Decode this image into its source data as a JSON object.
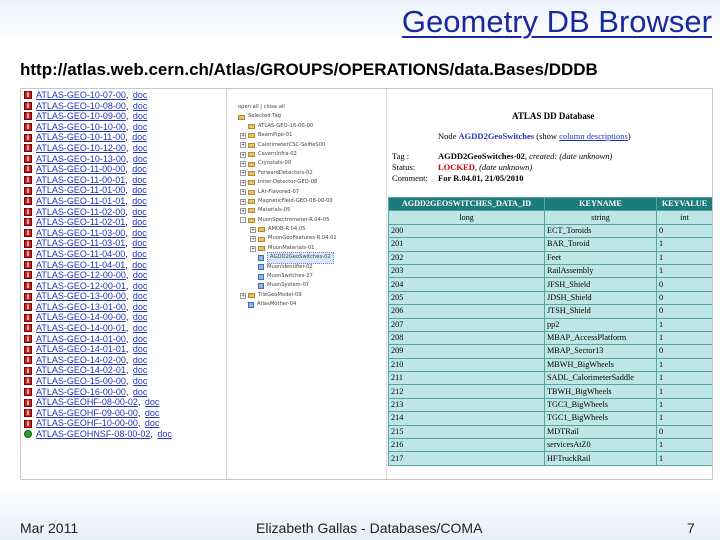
{
  "slide": {
    "title": "Geometry DB Browser",
    "url": "http://atlas.web.cern.ch/Atlas/GROUPS/OPERATIONS/data.Bases/DDDB"
  },
  "tag_list": [
    {
      "name": "ATLAS-GEO-10-07-00",
      "doc": "doc"
    },
    {
      "name": "ATLAS-GEO-10-08-00",
      "doc": "doc"
    },
    {
      "name": "ATLAS-GEO-10-09-00",
      "doc": "doc"
    },
    {
      "name": "ATLAS-GEO-10-10-00",
      "doc": "doc"
    },
    {
      "name": "ATLAS-GEO-10-11-00",
      "doc": "doc"
    },
    {
      "name": "ATLAS-GEO-10-12-00",
      "doc": "doc"
    },
    {
      "name": "ATLAS-GEO-10-13-00",
      "doc": "doc"
    },
    {
      "name": "ATLAS-GEO-11-00-00",
      "doc": "doc"
    },
    {
      "name": "ATLAS-GEO-11-00-01",
      "doc": "doc"
    },
    {
      "name": "ATLAS-GEO-11-01-00",
      "doc": "doc"
    },
    {
      "name": "ATLAS-GEO-11-01-01",
      "doc": "doc"
    },
    {
      "name": "ATLAS-GEO-11-02-00",
      "doc": "doc"
    },
    {
      "name": "ATLAS-GEO-11-02-01",
      "doc": "doc"
    },
    {
      "name": "ATLAS-GEO-11-03-00",
      "doc": "doc"
    },
    {
      "name": "ATLAS-GEO-11-03-01",
      "doc": "doc"
    },
    {
      "name": "ATLAS-GEO-11-04-00",
      "doc": "doc"
    },
    {
      "name": "ATLAS-GEO-11-04-01",
      "doc": "doc"
    },
    {
      "name": "ATLAS-GEO-12-00-00",
      "doc": "doc"
    },
    {
      "name": "ATLAS-GEO-12-00-01",
      "doc": "doc"
    },
    {
      "name": "ATLAS-GEO-13-00-00",
      "doc": "doc"
    },
    {
      "name": "ATLAS-GEO-13-01-00",
      "doc": "doc"
    },
    {
      "name": "ATLAS-GEO-14-00-00",
      "doc": "doc"
    },
    {
      "name": "ATLAS-GEO-14-00-01",
      "doc": "doc"
    },
    {
      "name": "ATLAS-GEO-14-01-00",
      "doc": "doc"
    },
    {
      "name": "ATLAS-GEO-14-01-01",
      "doc": "doc"
    },
    {
      "name": "ATLAS-GEO-14-02-00",
      "doc": "doc"
    },
    {
      "name": "ATLAS-GEO-14-02-01",
      "doc": "doc"
    },
    {
      "name": "ATLAS-GEO-15-00-00",
      "doc": "doc"
    },
    {
      "name": "ATLAS-GEO-16-00-00",
      "doc": "doc"
    },
    {
      "name": "ATLAS-GEOHF-08-00-02",
      "doc": "doc"
    },
    {
      "name": "ATLAS-GEOHF-09-00-00",
      "doc": "doc"
    },
    {
      "name": "ATLAS-GEOHF-10-00-00",
      "doc": "doc"
    },
    {
      "name": "ATLAS-GEOHNSF-08-00-02",
      "doc": "doc"
    }
  ],
  "tree": [
    {
      "label": "open all | close all",
      "depth": 0,
      "kind": "text"
    },
    {
      "label": "Selected Tag",
      "depth": 0,
      "kind": "folder"
    },
    {
      "label": "ATLAS-GEO-16-00-00",
      "depth": 1,
      "kind": "folder"
    },
    {
      "label": "BeamPipe-01",
      "depth": 1,
      "kind": "folder",
      "toggle": "+"
    },
    {
      "label": "CalorimeterCSC-SelfieS00",
      "depth": 1,
      "kind": "folder",
      "toggle": "+"
    },
    {
      "label": "CavernInfra-02",
      "depth": 1,
      "kind": "folder",
      "toggle": "+"
    },
    {
      "label": "Cryostats-00",
      "depth": 1,
      "kind": "folder",
      "toggle": "+"
    },
    {
      "label": "ForwardDetectors-02",
      "depth": 1,
      "kind": "folder",
      "toggle": "+"
    },
    {
      "label": "Inner-Detector-GEO-08",
      "depth": 1,
      "kind": "folder",
      "toggle": "+"
    },
    {
      "label": "LAr-Flavored-07",
      "depth": 1,
      "kind": "folder",
      "toggle": "+"
    },
    {
      "label": "MagneticField-GEO-08-00-00",
      "depth": 1,
      "kind": "folder",
      "toggle": "+"
    },
    {
      "label": "Materials-05",
      "depth": 1,
      "kind": "folder",
      "toggle": "+"
    },
    {
      "label": "MuonSpectrometer-R.04-05",
      "depth": 1,
      "kind": "folder",
      "toggle": "-"
    },
    {
      "label": "AMDB-R.04.05",
      "depth": 2,
      "kind": "folder",
      "toggle": "+"
    },
    {
      "label": "MuonGeoFeatures-R.04.01",
      "depth": 2,
      "kind": "folder",
      "toggle": "+"
    },
    {
      "label": "MuonMaterials-01",
      "depth": 2,
      "kind": "folder",
      "toggle": "+"
    },
    {
      "label": "AGDD2GeoSwitches-02",
      "depth": 2,
      "kind": "leaf",
      "selected": true
    },
    {
      "label": "MuonIdentifier-02",
      "depth": 2,
      "kind": "leaf"
    },
    {
      "label": "MuonSwitches-27",
      "depth": 2,
      "kind": "leaf"
    },
    {
      "label": "MuonSystem-07",
      "depth": 2,
      "kind": "leaf"
    },
    {
      "label": "TileGeoModel-09",
      "depth": 1,
      "kind": "folder",
      "toggle": "+"
    },
    {
      "label": "AtlasMother-04",
      "depth": 1,
      "kind": "leaf"
    }
  ],
  "db_panel": {
    "header": "ATLAS DD Database",
    "node_prefix": "Node",
    "node_name": "AGDD2GeoSwitches",
    "show_prefix": "(show",
    "column_desc_link": "column descriptions",
    "show_suffix": ")",
    "tag_label": "Tag :",
    "tag_value": "AGDD2GeoSwitches-02",
    "tag_created": ", created: (date unknown)",
    "status_label": "Status:",
    "status_value": "LOCKED",
    "status_date": ", (date unknown)",
    "comment_label": "Comment:",
    "comment_value": "For R.04.01, 21/05/2010",
    "columns": [
      "AGDD2GEOSWITCHES_DATA_ID",
      "KEYNAME",
      "KEYVALUE"
    ],
    "types": [
      "long",
      "string",
      "int"
    ],
    "rows": [
      [
        "200",
        "ECT_Toroids",
        "0"
      ],
      [
        "201",
        "BAR_Toroid",
        "1"
      ],
      [
        "202",
        "Feet",
        "1"
      ],
      [
        "203",
        "RailAssembly",
        "1"
      ],
      [
        "204",
        "JFSH_Shield",
        "0"
      ],
      [
        "205",
        "JDSH_Shield",
        "0"
      ],
      [
        "206",
        "JTSH_Shield",
        "0"
      ],
      [
        "207",
        "pp2",
        "1"
      ],
      [
        "208",
        "MBAP_AccessPlatform",
        "1"
      ],
      [
        "209",
        "MBAP_Sector13",
        "0"
      ],
      [
        "210",
        "MBWH_BigWheels",
        "1"
      ],
      [
        "211",
        "SADL_CalorimeterSaddle",
        "1"
      ],
      [
        "212",
        "TBWH_BigWheels",
        "1"
      ],
      [
        "213",
        "TGC3_BigWheels",
        "1"
      ],
      [
        "214",
        "TGC1_BigWheels",
        "1"
      ],
      [
        "215",
        "MDTRail",
        "0"
      ],
      [
        "216",
        "servicesAtZ0",
        "1"
      ],
      [
        "217",
        "HFTruckRail",
        "1"
      ]
    ]
  },
  "footer": {
    "left": "Mar 2011",
    "center": "Elizabeth Gallas - Databases/COMA",
    "page": "7"
  },
  "colors": {
    "title": "#1a2a9c",
    "link": "#2233bb",
    "table_header": "#1c7c7c",
    "table_cell": "#bfe6e6",
    "locked": "#d40000"
  }
}
